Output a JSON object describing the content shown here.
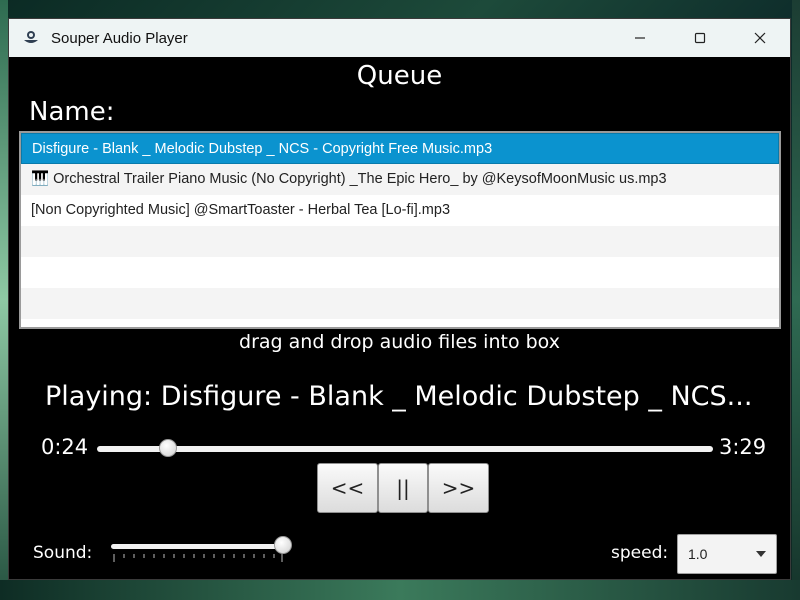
{
  "window": {
    "title": "Souper Audio Player",
    "app_icon": "souper-app-icon",
    "controls": {
      "minimize": "—",
      "maximize": "☐",
      "close": "✕"
    }
  },
  "queue": {
    "title": "Queue",
    "name_label": "Name:",
    "items": [
      "Disfigure - Blank _ Melodic Dubstep _ NCS - Copyright Free Music.mp3",
      "🎹 Orchestral Trailer Piano Music (No Copyright) _The Epic Hero_ by @KeysofMoonMusic  us.mp3",
      "[Non Copyrighted Music] @SmartToaster  - Herbal Tea [Lo-fi].mp3"
    ],
    "selected_index": 0,
    "hint": "drag and drop audio files into box"
  },
  "player": {
    "now_playing": "Playing: Disfigure - Blank _ Melodic Dubstep _ NCS...",
    "current_time": "0:24",
    "total_time": "3:29",
    "progress_fraction": 0.115,
    "prev_label": "<<",
    "pause_label": "||",
    "next_label": ">>"
  },
  "sound": {
    "label": "Sound:",
    "volume_fraction": 1.0
  },
  "speed": {
    "label": "speed:",
    "value": "1.0"
  },
  "colors": {
    "selection": "#0b93cf",
    "window_bg": "#000000",
    "titlebar_bg": "#eef4f4"
  }
}
